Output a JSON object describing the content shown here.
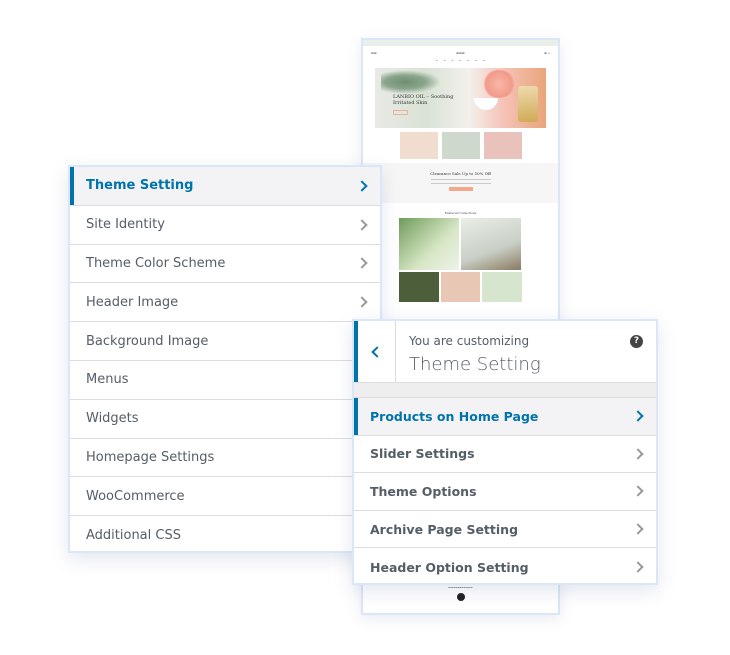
{
  "preview": {
    "hero_title": "LANBIO OIL – Soothing Irritated Skin",
    "sale_title": "Clearance Sale Up to 50% Off",
    "featured_title": "Featured Collections"
  },
  "left_panel": {
    "items": [
      {
        "label": "Theme Setting",
        "active": true,
        "chevron": true
      },
      {
        "label": "Site Identity",
        "chevron": true
      },
      {
        "label": "Theme Color Scheme",
        "chevron": true
      },
      {
        "label": "Header Image",
        "chevron": true
      },
      {
        "label": "Background Image",
        "chevron": false
      },
      {
        "label": "Menus",
        "chevron": false
      },
      {
        "label": "Widgets",
        "chevron": false
      },
      {
        "label": "Homepage Settings",
        "chevron": false
      },
      {
        "label": "WooCommerce",
        "chevron": false
      },
      {
        "label": "Additional CSS",
        "chevron": false
      }
    ]
  },
  "right_panel": {
    "subtitle": "You are customizing",
    "title": "Theme Setting",
    "help_icon": "?",
    "items": [
      {
        "label": "Products on Home Page",
        "active": true
      },
      {
        "label": "Slider Settings"
      },
      {
        "label": "Theme Options"
      },
      {
        "label": "Archive Page Setting"
      },
      {
        "label": "Header Option Setting"
      }
    ]
  },
  "colors": {
    "accent": "#0073aa",
    "text": "#555d66",
    "border": "#dbe6f8"
  }
}
